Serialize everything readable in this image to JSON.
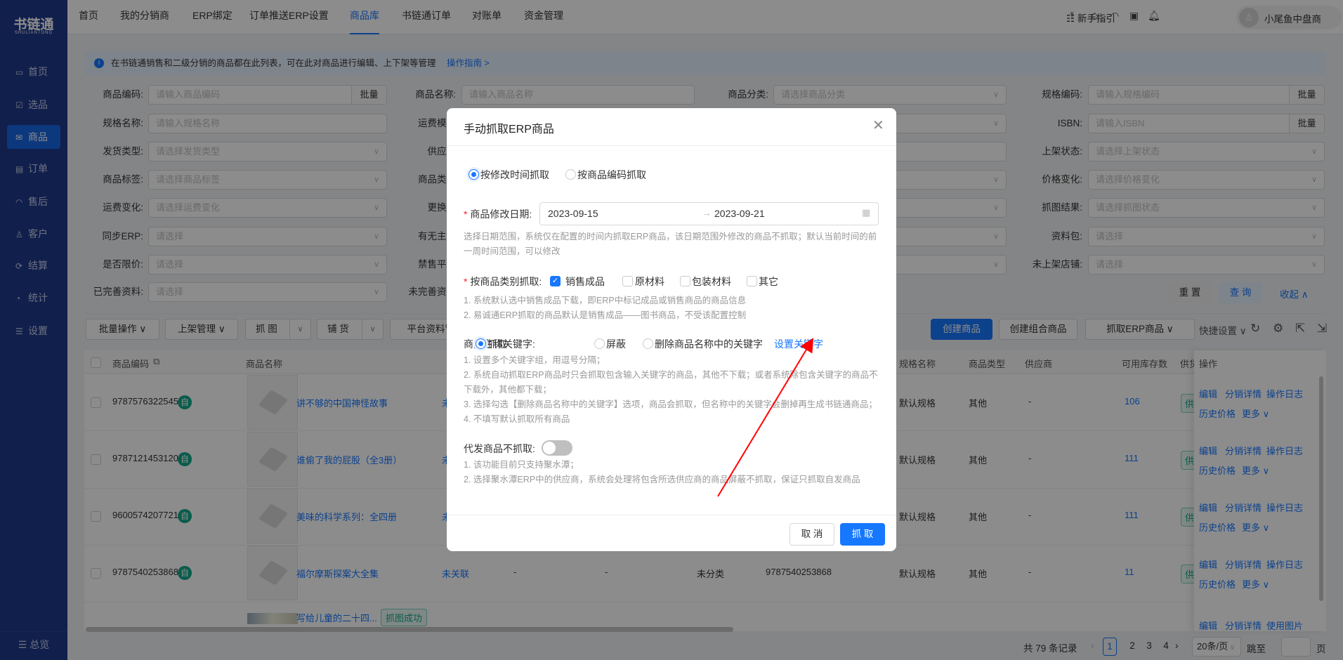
{
  "app": {
    "logo": "书链通",
    "logo_sub": "SHULIANTONG"
  },
  "topnav": {
    "items": [
      "首页",
      "我的分销商",
      "ERP绑定",
      "订单推送ERP设置",
      "商品库",
      "书链通订单",
      "对账单",
      "资金管理"
    ],
    "active_index": 4,
    "guide": "新手指引",
    "icons": [
      "upload-icon",
      "tag-icon",
      "headset-icon",
      "robot-icon",
      "bell-icon"
    ],
    "user": "小尾鱼中盘商"
  },
  "sidebar": {
    "items": [
      {
        "label": "首页",
        "icon": "monitor-icon"
      },
      {
        "label": "选品",
        "icon": "checklist-icon"
      },
      {
        "label": "商品",
        "icon": "box-icon"
      },
      {
        "label": "订单",
        "icon": "document-icon"
      },
      {
        "label": "售后",
        "icon": "headset-icon"
      },
      {
        "label": "客户",
        "icon": "users-icon"
      },
      {
        "label": "结算",
        "icon": "settle-icon"
      },
      {
        "label": "统计",
        "icon": "pie-chart-icon"
      },
      {
        "label": "设置",
        "icon": "sliders-icon"
      }
    ],
    "active_index": 2,
    "footer": "总览"
  },
  "banner": {
    "text": "在书链通销售和二级分销的商品都在此列表，可在此对商品进行编辑、上下架等管理",
    "link": "操作指南 >"
  },
  "filters": {
    "batch_label": "批量",
    "columns": [
      [
        {
          "label": "商品编码:",
          "placeholder": "请输入商品编码",
          "type": "batch"
        },
        {
          "label": "规格名称:",
          "placeholder": "请输入规格名称",
          "type": "input"
        },
        {
          "label": "发货类型:",
          "placeholder": "请选择发货类型",
          "type": "select"
        },
        {
          "label": "商品标签:",
          "placeholder": "请选择商品标签",
          "type": "select"
        },
        {
          "label": "运费变化:",
          "placeholder": "请选择运费变化",
          "type": "select"
        },
        {
          "label": "同步ERP:",
          "placeholder": "请选择",
          "type": "select"
        },
        {
          "label": "是否限价:",
          "placeholder": "请选择",
          "type": "select"
        },
        {
          "label": "已完善资料:",
          "placeholder": "请选择",
          "type": "select"
        }
      ],
      [
        {
          "label": "商品名称:",
          "placeholder": "请输入商品名称",
          "type": "input"
        },
        {
          "label": "运费模板",
          "placeholder": "",
          "type": "select"
        },
        {
          "label": "供应商",
          "placeholder": "",
          "type": "select"
        },
        {
          "label": "商品类型",
          "placeholder": "",
          "type": "select"
        },
        {
          "label": "更换供",
          "placeholder": "",
          "type": "select"
        },
        {
          "label": "有无主图",
          "placeholder": "",
          "type": "select"
        },
        {
          "label": "禁售平台",
          "placeholder": "",
          "type": "select"
        },
        {
          "label": "未完善资料",
          "placeholder": "",
          "type": "select"
        }
      ],
      [
        {
          "label": "商品分类:",
          "placeholder": "请选择商品分类",
          "type": "select"
        },
        {
          "label": "",
          "placeholder": "",
          "type": "select"
        },
        {
          "label": "",
          "placeholder": "",
          "type": "input"
        },
        {
          "label": "",
          "placeholder": "",
          "type": "select"
        },
        {
          "label": "",
          "placeholder": "",
          "type": "select"
        },
        {
          "label": "",
          "placeholder": "",
          "type": "select"
        },
        {
          "label": "",
          "placeholder": "",
          "type": "select"
        }
      ],
      [
        {
          "label": "规格编码:",
          "placeholder": "请输入规格编码",
          "type": "batch"
        },
        {
          "label": "ISBN:",
          "placeholder": "请输入ISBN",
          "type": "batch"
        },
        {
          "label": "上架状态:",
          "placeholder": "请选择上架状态",
          "type": "select"
        },
        {
          "label": "价格变化:",
          "placeholder": "请选择价格变化",
          "type": "select"
        },
        {
          "label": "抓图结果:",
          "placeholder": "请选择抓图状态",
          "type": "select"
        },
        {
          "label": "资料包:",
          "placeholder": "请选择",
          "type": "select"
        },
        {
          "label": "未上架店铺:",
          "placeholder": "请选择",
          "type": "select"
        }
      ]
    ],
    "reset": "重 置",
    "search": "查 询",
    "collapse": "收起 ∧"
  },
  "toolbar": {
    "left": [
      "批量操作 ∨",
      "上架管理 ∨",
      "抓 图",
      "铺 货",
      "平台资料管理"
    ],
    "right": {
      "create": "创建商品",
      "create_combo": "创建组合商品",
      "fetch_erp": "抓取ERP商品 ∨",
      "quick": "快捷设置 ∨"
    },
    "icons": [
      "refresh-icon",
      "gear-icon",
      "export-icon",
      "import-icon"
    ]
  },
  "table": {
    "headers": {
      "code": "商品编码",
      "name": "商品名称",
      "spec": "规格名称",
      "type": "商品类型",
      "supplier": "供应商",
      "stock": "可用库存数",
      "supply": "供货",
      "actions": "操作"
    },
    "self_badge": "自",
    "supply_badge": "供",
    "rows": [
      {
        "code": "9787576322545",
        "name": "讲不够的中国神怪故事",
        "link": "未关联",
        "spec": "默认规格",
        "type": "其他",
        "supplier": "-",
        "stock": "106",
        "actions": [
          "编辑",
          "分销详情",
          "操作日志",
          "历史价格",
          "更多 ∨"
        ]
      },
      {
        "code": "9787121453120",
        "name": "谁偷了我的屁股（全3册）",
        "link": "未关联",
        "spec": "默认规格",
        "type": "其他",
        "supplier": "-",
        "stock": "111",
        "actions": [
          "编辑",
          "分销详情",
          "操作日志",
          "历史价格",
          "更多 ∨"
        ]
      },
      {
        "code": "9600574207721",
        "name": "美味的科学系列：全四册",
        "link": "未关联",
        "spec": "默认规格",
        "type": "其他",
        "supplier": "-",
        "stock": "111",
        "actions": [
          "编辑",
          "分销详情",
          "操作日志",
          "历史价格",
          "更多 ∨"
        ]
      },
      {
        "code": "9787540253868",
        "name": "福尔摩斯探案大全集",
        "link": "未关联",
        "c1": "-",
        "c2": "-",
        "category": "未分类",
        "isbn": "9787540253868",
        "spec": "默认规格",
        "type": "其他",
        "supplier": "-",
        "stock": "11",
        "actions": [
          "编辑",
          "分销详情",
          "操作日志",
          "历史价格",
          "更多 ∨"
        ]
      },
      {
        "code": "",
        "name": "写给儿童的二十四...",
        "badge": "抓图成功",
        "actions": [
          "编辑",
          "分销详情",
          "使用图片"
        ]
      }
    ]
  },
  "pagination": {
    "total": "共 79 条记录",
    "pages": [
      "1",
      "2",
      "3",
      "4"
    ],
    "current": "1",
    "page_size": "20条/页",
    "jump": "跳至",
    "page_unit": "页"
  },
  "dialog": {
    "title": "手动抓取ERP商品",
    "mode_options": [
      "按修改时间抓取",
      "按商品编码抓取"
    ],
    "mode_selected": 0,
    "date_label": "商品修改日期:",
    "date_start": "2023-09-15",
    "date_end": "2023-09-21",
    "date_help": "选择日期范围，系统仅在配置的时间内抓取ERP商品，该日期范围外修改的商品不抓取；默认当前时间的前一周时间范围，可以修改",
    "category_label": "按商品类别抓取:",
    "categories": [
      {
        "label": "销售成品",
        "checked": true
      },
      {
        "label": "原材料",
        "checked": false
      },
      {
        "label": "包装材料",
        "checked": false
      },
      {
        "label": "其它",
        "checked": false
      }
    ],
    "category_help": [
      "1. 系统默认选中销售成品下载，即ERP中标记成品或销售商品的商品信息",
      "2. 易诚通ERP抓取的商品默认是销售成品——图书商品，不受该配置控制"
    ],
    "keyword_label": "商品名称关键字:",
    "keyword_options": [
      "抓取",
      "屏蔽",
      "删除商品名称中的关键字"
    ],
    "keyword_selected": 0,
    "keyword_link": "设置关键字",
    "keyword_help": [
      "1. 设置多个关键字组，用逗号分隔；",
      "2. 系统自动抓取ERP商品时只会抓取包含输入关键字的商品，其他不下载；或者系统除包含关键字的商品不下载外，其他都下载；",
      "3. 选择勾选【删除商品名称中的关键字】选项，商品会抓取，但名称中的关键字会删掉再生成书链通商品；",
      "4. 不填写默认抓取所有商品"
    ],
    "dropship_label": "代发商品不抓取:",
    "dropship_on": false,
    "dropship_help": [
      "1. 该功能目前只支持聚水潭；",
      "2. 选择聚水潭ERP中的供应商，系统会处理将包含所选供应商的商品屏蔽不抓取，保证只抓取自发商品"
    ],
    "cancel": "取 消",
    "confirm": "抓 取"
  },
  "colors": {
    "primary": "#1677ff",
    "sidebar": "#1f3a8a",
    "annotation_arrow": "#ff0000"
  }
}
